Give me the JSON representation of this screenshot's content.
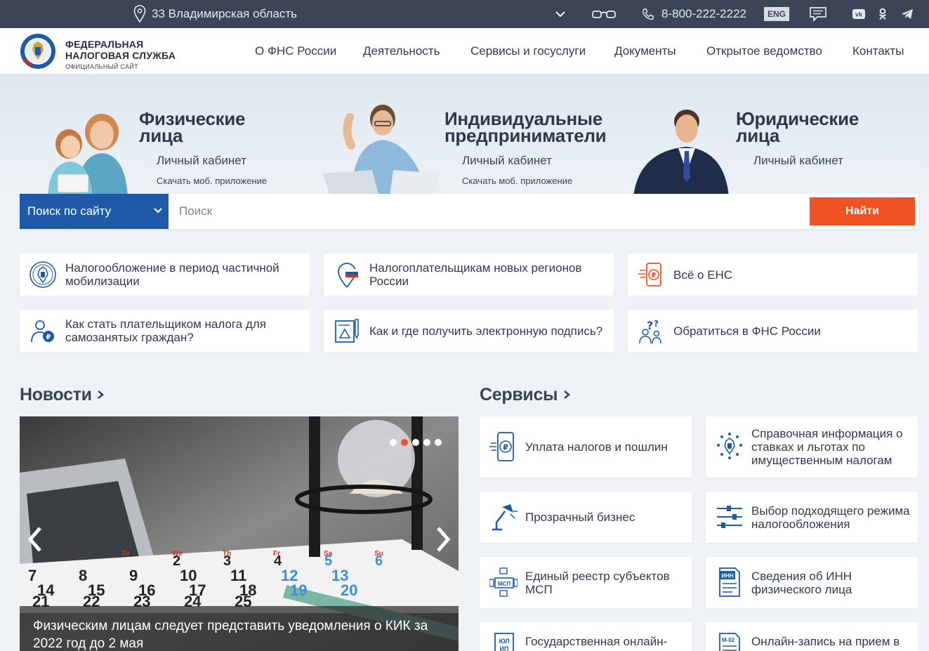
{
  "topbar": {
    "region": "33 Владимирская область",
    "phone": "8-800-222-2222",
    "lang": "ENG",
    "icons": [
      "location-pin-icon",
      "chevron-down-icon",
      "glasses-icon",
      "phone-icon",
      "chat-icon",
      "vk-icon",
      "ok-icon",
      "telegram-icon"
    ]
  },
  "header": {
    "logo_line1": "ФЕДЕРАЛЬНАЯ",
    "logo_line2": "НАЛОГОВАЯ СЛУЖБА",
    "logo_line3": "ОФИЦИАЛЬНЫЙ САЙТ",
    "nav": [
      "О ФНС России",
      "Деятельность",
      "Сервисы и госуслуги",
      "Документы",
      "Открытое ведомство",
      "Контакты"
    ]
  },
  "hero": {
    "individuals": {
      "title1": "Физические",
      "title2": "лица",
      "cabinet": "Личный кабинет",
      "app": "Скачать моб. приложение"
    },
    "entrepreneurs": {
      "title1": "Индивидуальные",
      "title2": "предприниматели",
      "cabinet": "Личный кабинет",
      "app": "Скачать моб. приложение"
    },
    "legal": {
      "title1": "Юридические",
      "title2": "лица",
      "cabinet": "Личный кабинет"
    }
  },
  "search": {
    "scope": "Поиск по сайту",
    "placeholder": "Поиск",
    "button": "Найти"
  },
  "quick_links": [
    {
      "text": "Налогообложение в период частичной мобилизации",
      "icon": "emblem-icon"
    },
    {
      "text": "Налогоплательщикам новых регионов России",
      "icon": "map-pin-flag-icon"
    },
    {
      "text": "Всё о ЕНС",
      "icon": "ruble-phone-icon"
    },
    {
      "text": "Как стать плательщиком налога для самозанятых граждан?",
      "icon": "self-employed-icon"
    },
    {
      "text": "Как и где получить электронную подпись?",
      "icon": "e-signature-icon"
    },
    {
      "text": "Обратиться в ФНС России",
      "icon": "question-person-icon"
    }
  ],
  "news": {
    "title": "Новости",
    "caption": "Физическим лицам следует представить уведомления о КИК за 2022 год до 2 мая",
    "slides_total": 5,
    "active_slide": 2,
    "calendar_row1": [
      "Tu",
      "We",
      "Th",
      "Fr",
      "Sa",
      "Su"
    ],
    "calendar_row2": [
      "2",
      "3",
      "4",
      "5",
      "6"
    ],
    "calendar_row3": [
      "7",
      "8",
      "9",
      "10",
      "11",
      "12",
      "13"
    ],
    "calendar_row4": [
      "14",
      "15",
      "16",
      "17",
      "18",
      "19",
      "20"
    ],
    "calendar_row5": [
      "21",
      "22",
      "23",
      "24",
      "25"
    ]
  },
  "services": {
    "title": "Сервисы",
    "items": [
      {
        "text": "Уплата налогов и пошлин",
        "icon": "ruble-phone-icon"
      },
      {
        "text": "Справочная информация о ставках и льготах по имущественным налогам",
        "icon": "emblem-dots-icon"
      },
      {
        "text": "Прозрачный бизнес",
        "icon": "desk-lamp-icon"
      },
      {
        "text": "Выбор подходящего режима налогообложения",
        "icon": "sliders-icon"
      },
      {
        "text": "Единый реестр субъектов МСП",
        "icon": "msp-network-icon",
        "badge": "МСП"
      },
      {
        "text": "Сведения об ИНН физического лица",
        "icon": "inn-document-icon",
        "badge": "ИНН"
      },
      {
        "text": "Государственная онлайн-",
        "icon": "ul-ip-icon",
        "badge1": "ЮЛ",
        "badge2": "ИП"
      },
      {
        "text": "Онлайн-запись на прием в",
        "icon": "m02-document-icon",
        "badge": "М-02"
      }
    ]
  },
  "colors": {
    "topbar": "#3c4557",
    "accent_blue": "#1e5aa8",
    "accent_orange": "#ef5323",
    "icon_blue": "#1e5aa8"
  }
}
